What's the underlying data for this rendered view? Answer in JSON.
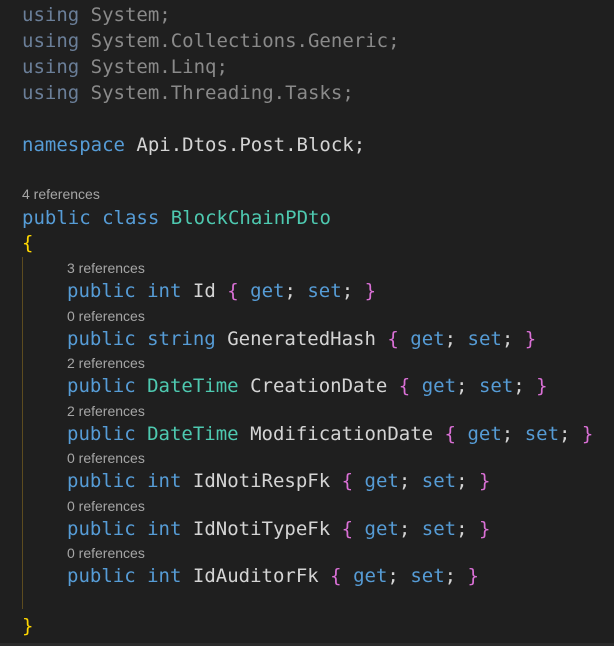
{
  "usings": [
    {
      "keyword": "using",
      "namespace": "System",
      "terminator": ";"
    },
    {
      "keyword": "using",
      "namespace": "System.Collections.Generic",
      "terminator": ";"
    },
    {
      "keyword": "using",
      "namespace": "System.Linq",
      "terminator": ";"
    },
    {
      "keyword": "using",
      "namespace": "System.Threading.Tasks",
      "terminator": ";"
    }
  ],
  "namespace_decl": {
    "keyword": "namespace",
    "name": "Api.Dtos.Post.Block",
    "terminator": ";"
  },
  "class_decl": {
    "codelens": "4 references",
    "modifier": "public",
    "keyword": "class",
    "name": "BlockChainPDto",
    "open_brace": "{",
    "close_brace": "}"
  },
  "properties": [
    {
      "codelens": "3 references",
      "modifier": "public",
      "type": "int",
      "name": "Id",
      "accessors": "get; set;",
      "get": "get",
      "set": "set"
    },
    {
      "codelens": "0 references",
      "modifier": "public",
      "type": "string",
      "name": "GeneratedHash",
      "get": "get",
      "set": "set"
    },
    {
      "codelens": "2 references",
      "modifier": "public",
      "type": "DateTime",
      "name": "CreationDate",
      "get": "get",
      "set": "set"
    },
    {
      "codelens": "2 references",
      "modifier": "public",
      "type": "DateTime",
      "name": "ModificationDate",
      "get": "get",
      "set": "set"
    },
    {
      "codelens": "0 references",
      "modifier": "public",
      "type": "int",
      "name": "IdNotiRespFk",
      "get": "get",
      "set": "set"
    },
    {
      "codelens": "0 references",
      "modifier": "public",
      "type": "int",
      "name": "IdNotiTypeFk",
      "get": "get",
      "set": "set"
    },
    {
      "codelens": "0 references",
      "modifier": "public",
      "type": "int",
      "name": "IdAuditorFk",
      "get": "get",
      "set": "set"
    }
  ],
  "colors": {
    "background": "#1f1f1f",
    "keyword": "#569cd6",
    "type_name": "#4ec9b0",
    "identifier": "#d4d4d4",
    "brace_level1": "#ffd700",
    "brace_level2": "#da70d6",
    "codelens": "#a6a6a6",
    "indent_guide": "#5c4b1f"
  }
}
